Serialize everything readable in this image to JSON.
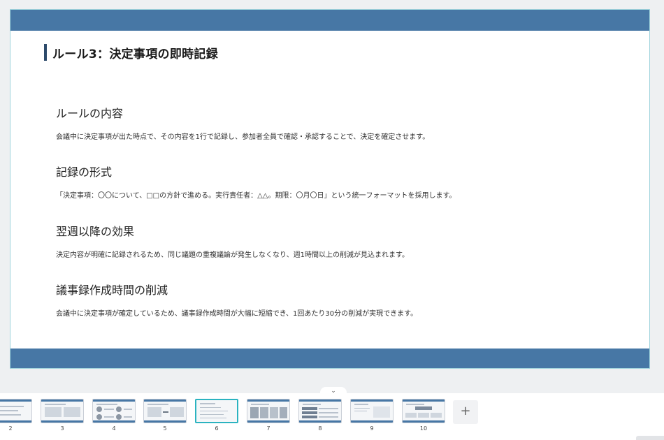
{
  "slide": {
    "title": "ルール3：決定事項の即時記録",
    "sections": [
      {
        "heading": "ルールの内容",
        "body": "会議中に決定事項が出た時点で、その内容を1行で記録し、参加者全員で確認・承認することで、決定を確定させます。"
      },
      {
        "heading": "記録の形式",
        "body": "「決定事項：〇〇について、□□の方針で進める。実行責任者：△△。期限：〇月〇日」という統一フォーマットを採用します。"
      },
      {
        "heading": "翌週以降の効果",
        "body": "決定内容が明確に記録されるため、同じ議題の重複議論が発生しなくなり、週1時間以上の削減が見込まれます。"
      },
      {
        "heading": "議事録作成時間の削減",
        "body": "会議中に決定事項が確定しているため、議事録作成時間が大幅に短縮でき、1回あたり30分の削減が実現できます。"
      }
    ]
  },
  "filmstrip": {
    "collapse_glyph": "⌄",
    "add_glyph": "+",
    "thumbnails": [
      {
        "number": "2"
      },
      {
        "number": "3"
      },
      {
        "number": "4"
      },
      {
        "number": "5"
      },
      {
        "number": "6",
        "active": true
      },
      {
        "number": "7"
      },
      {
        "number": "8"
      },
      {
        "number": "9"
      },
      {
        "number": "10"
      }
    ]
  },
  "colors": {
    "slide_band": "#4777a5",
    "title_accent": "#2d4a6b",
    "active_thumb_border": "#2bb3c0"
  }
}
